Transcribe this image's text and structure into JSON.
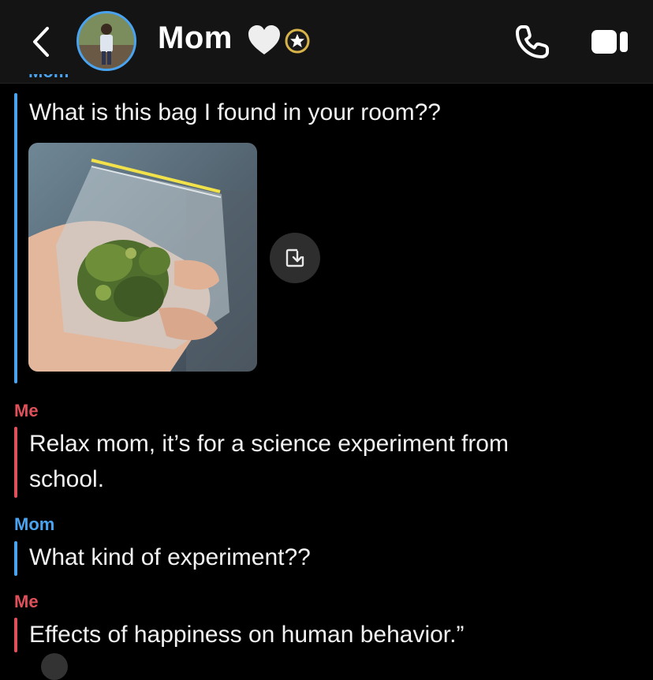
{
  "header": {
    "title": "Mom",
    "back_icon": "chevron-left-icon",
    "heart_icon": "white-heart-icon",
    "badge_icon": "star-badge-icon",
    "call_icon": "phone-icon",
    "video_icon": "video-camera-icon"
  },
  "chat": {
    "overflow_label": "Mom",
    "messages": [
      {
        "sender": "Mom",
        "text": "What is this bag I found in your room??"
      },
      {
        "sender": "Me",
        "lines": [
          "Relax mom, it’s for a science experiment from",
          "school."
        ]
      },
      {
        "sender": "Mom",
        "text": "What kind of experiment??"
      },
      {
        "sender": "Me",
        "text": "Effects of happiness on human behavior.”"
      }
    ]
  },
  "colors": {
    "mom_accent": "#4aa3f0",
    "me_accent": "#e0505a",
    "background": "#000000",
    "header_bg": "#141414"
  }
}
